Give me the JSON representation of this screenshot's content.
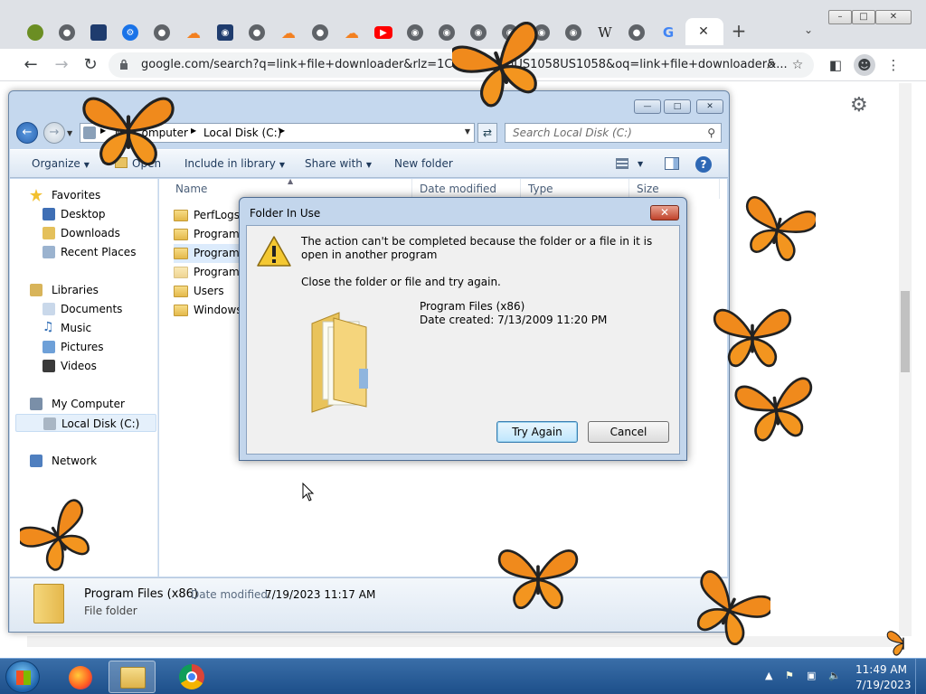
{
  "browser": {
    "window_controls": {
      "minimize": "–",
      "restore": "□",
      "close": "✕"
    },
    "tabs": [
      {
        "icon": "extension-icon"
      },
      {
        "icon": "globe-icon"
      },
      {
        "icon": "news-icon"
      },
      {
        "icon": "gear-icon"
      },
      {
        "icon": "globe-icon"
      },
      {
        "icon": "cloudflare-icon"
      },
      {
        "icon": "camera-icon"
      },
      {
        "icon": "globe-icon"
      },
      {
        "icon": "cloudflare-icon"
      },
      {
        "icon": "globe-icon"
      },
      {
        "icon": "cloudflare-icon"
      },
      {
        "icon": "youtube-icon"
      },
      {
        "icon": "chrome-icon"
      },
      {
        "icon": "chrome-icon"
      },
      {
        "icon": "chrome-icon"
      },
      {
        "icon": "chrome-icon"
      },
      {
        "icon": "chrome-icon"
      },
      {
        "icon": "chrome-icon"
      },
      {
        "icon": "wikipedia-icon",
        "glyph": "W"
      },
      {
        "icon": "globe-icon"
      },
      {
        "icon": "google-icon",
        "glyph": "G"
      }
    ],
    "url": "google.com/search?q=link+file+downloader&rlz=1C1GCEU_enUS1058US1058&oq=link+file+downloader&...",
    "new_tab_glyph": "+",
    "tab_close_glyph": "✕"
  },
  "explorer": {
    "breadcrumbs": [
      "My Computer",
      "Local Disk (C:)"
    ],
    "search_placeholder": "Search Local Disk (C:)",
    "commands": {
      "organize": "Organize",
      "open": "Open",
      "include_in_library": "Include in library",
      "share_with": "Share with",
      "new_folder": "New folder"
    },
    "nav": {
      "favorites": "Favorites",
      "favorites_items": [
        "Desktop",
        "Downloads",
        "Recent Places"
      ],
      "libraries": "Libraries",
      "libraries_items": [
        "Documents",
        "Music",
        "Pictures",
        "Videos"
      ],
      "computer": "My Computer",
      "computer_items": [
        "Local Disk (C:)"
      ],
      "network": "Network"
    },
    "columns": [
      "Name",
      "Date modified",
      "Type",
      "Size"
    ],
    "files": [
      "PerfLogs",
      "Program",
      "Program",
      "ProgramD",
      "Users",
      "Windows"
    ],
    "selected_file_index": 2,
    "details": {
      "name": "Program Files (x86)",
      "modified_label": "Date modified:",
      "modified": "7/19/2023 11:17 AM",
      "type": "File folder"
    }
  },
  "dialog": {
    "title": "Folder In Use",
    "message": "The action can't be completed because the folder or a file in it is open in another program",
    "hint": "Close the folder or file and try again.",
    "folder_name": "Program Files (x86)",
    "folder_date": "Date created: 7/13/2009 11:20 PM",
    "try_again": "Try Again",
    "cancel": "Cancel"
  },
  "taskbar": {
    "apps": [
      "firefox-icon",
      "file-explorer-icon",
      "chrome-icon"
    ],
    "active_app": "file-explorer-icon",
    "time": "11:49 AM",
    "date": "7/19/2023"
  },
  "colors": {
    "butterfly": "#f08a1c",
    "dialog_frame": "#c3d6ec",
    "taskbar": "#2a5f9c"
  }
}
